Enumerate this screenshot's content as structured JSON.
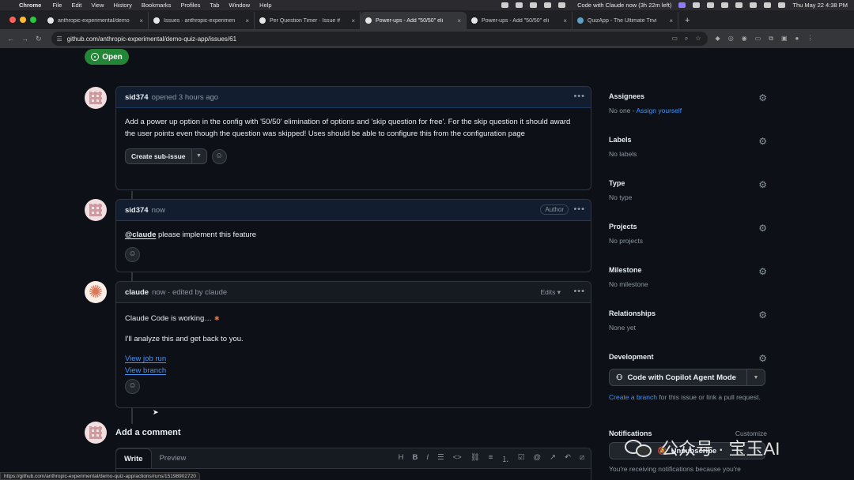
{
  "menubar": {
    "app": "Chrome",
    "items": [
      "File",
      "Edit",
      "View",
      "History",
      "Bookmarks",
      "Profiles",
      "Tab",
      "Window",
      "Help"
    ],
    "status_text": "Code with Claude now (3h 22m left)",
    "datetime": "Thu May 22  4:38 PM"
  },
  "tabs": [
    {
      "title": "anthropic-experimental/demo",
      "active": false
    },
    {
      "title": "Issues · anthropic-experimen",
      "active": false
    },
    {
      "title": "Per Question Timer · Issue #",
      "active": false
    },
    {
      "title": "Power-ups - Add \"50/50\" eli",
      "active": true
    },
    {
      "title": "Power-ups - Add \"50/50\" eli",
      "active": false
    },
    {
      "title": "QuizApp - The Ultimate Trivi",
      "active": false
    }
  ],
  "address": {
    "url": "github.com/anthropic-experimental/demo-quiz-app/issues/61"
  },
  "issue": {
    "state_label": "Open"
  },
  "comments": [
    {
      "author": "sid374",
      "meta": "opened 3 hours ago",
      "body": "Add a power up option in the config with '50/50' elimination of options and 'skip question for free'. For the skip question it should award the user points even though the question was skipped! Uses should be able to configure this from the configuration page",
      "sub_issue_label": "Create sub-issue"
    },
    {
      "author": "sid374",
      "meta": "now",
      "badge": "Author",
      "mention": "@claude",
      "body": " please implement this feature"
    },
    {
      "author": "claude",
      "meta": "now · edited by claude",
      "edits_label": "Edits",
      "line1": "Claude Code is working…",
      "line2": "I'll analyze this and get back to you.",
      "link1": "View job run",
      "link2": "View branch"
    }
  ],
  "add_comment": {
    "heading": "Add a comment",
    "tab_write": "Write",
    "tab_preview": "Preview"
  },
  "sidebar": {
    "assignees": {
      "title": "Assignees",
      "value": "No one - ",
      "link": "Assign yourself"
    },
    "labels": {
      "title": "Labels",
      "value": "No labels"
    },
    "type": {
      "title": "Type",
      "value": "No type"
    },
    "projects": {
      "title": "Projects",
      "value": "No projects"
    },
    "milestone": {
      "title": "Milestone",
      "value": "No milestone"
    },
    "relationships": {
      "title": "Relationships",
      "value": "None yet"
    },
    "development": {
      "title": "Development",
      "button": "Code with Copilot Agent Mode",
      "link": "Create a branch",
      "text": " for this issue or link a pull request."
    },
    "notifications": {
      "title": "Notifications",
      "customize": "Customize",
      "button": "Unsubscribe",
      "text": "You're receiving notifications because you're"
    }
  },
  "status_url": "https://github.com/anthropic-experimental/demo-quiz-app/actions/runs/15198902720",
  "watermark": "公众号 · 宝玉AI",
  "colors": {
    "open": "#238636",
    "link": "#4493f8",
    "claude": "#d97757"
  }
}
